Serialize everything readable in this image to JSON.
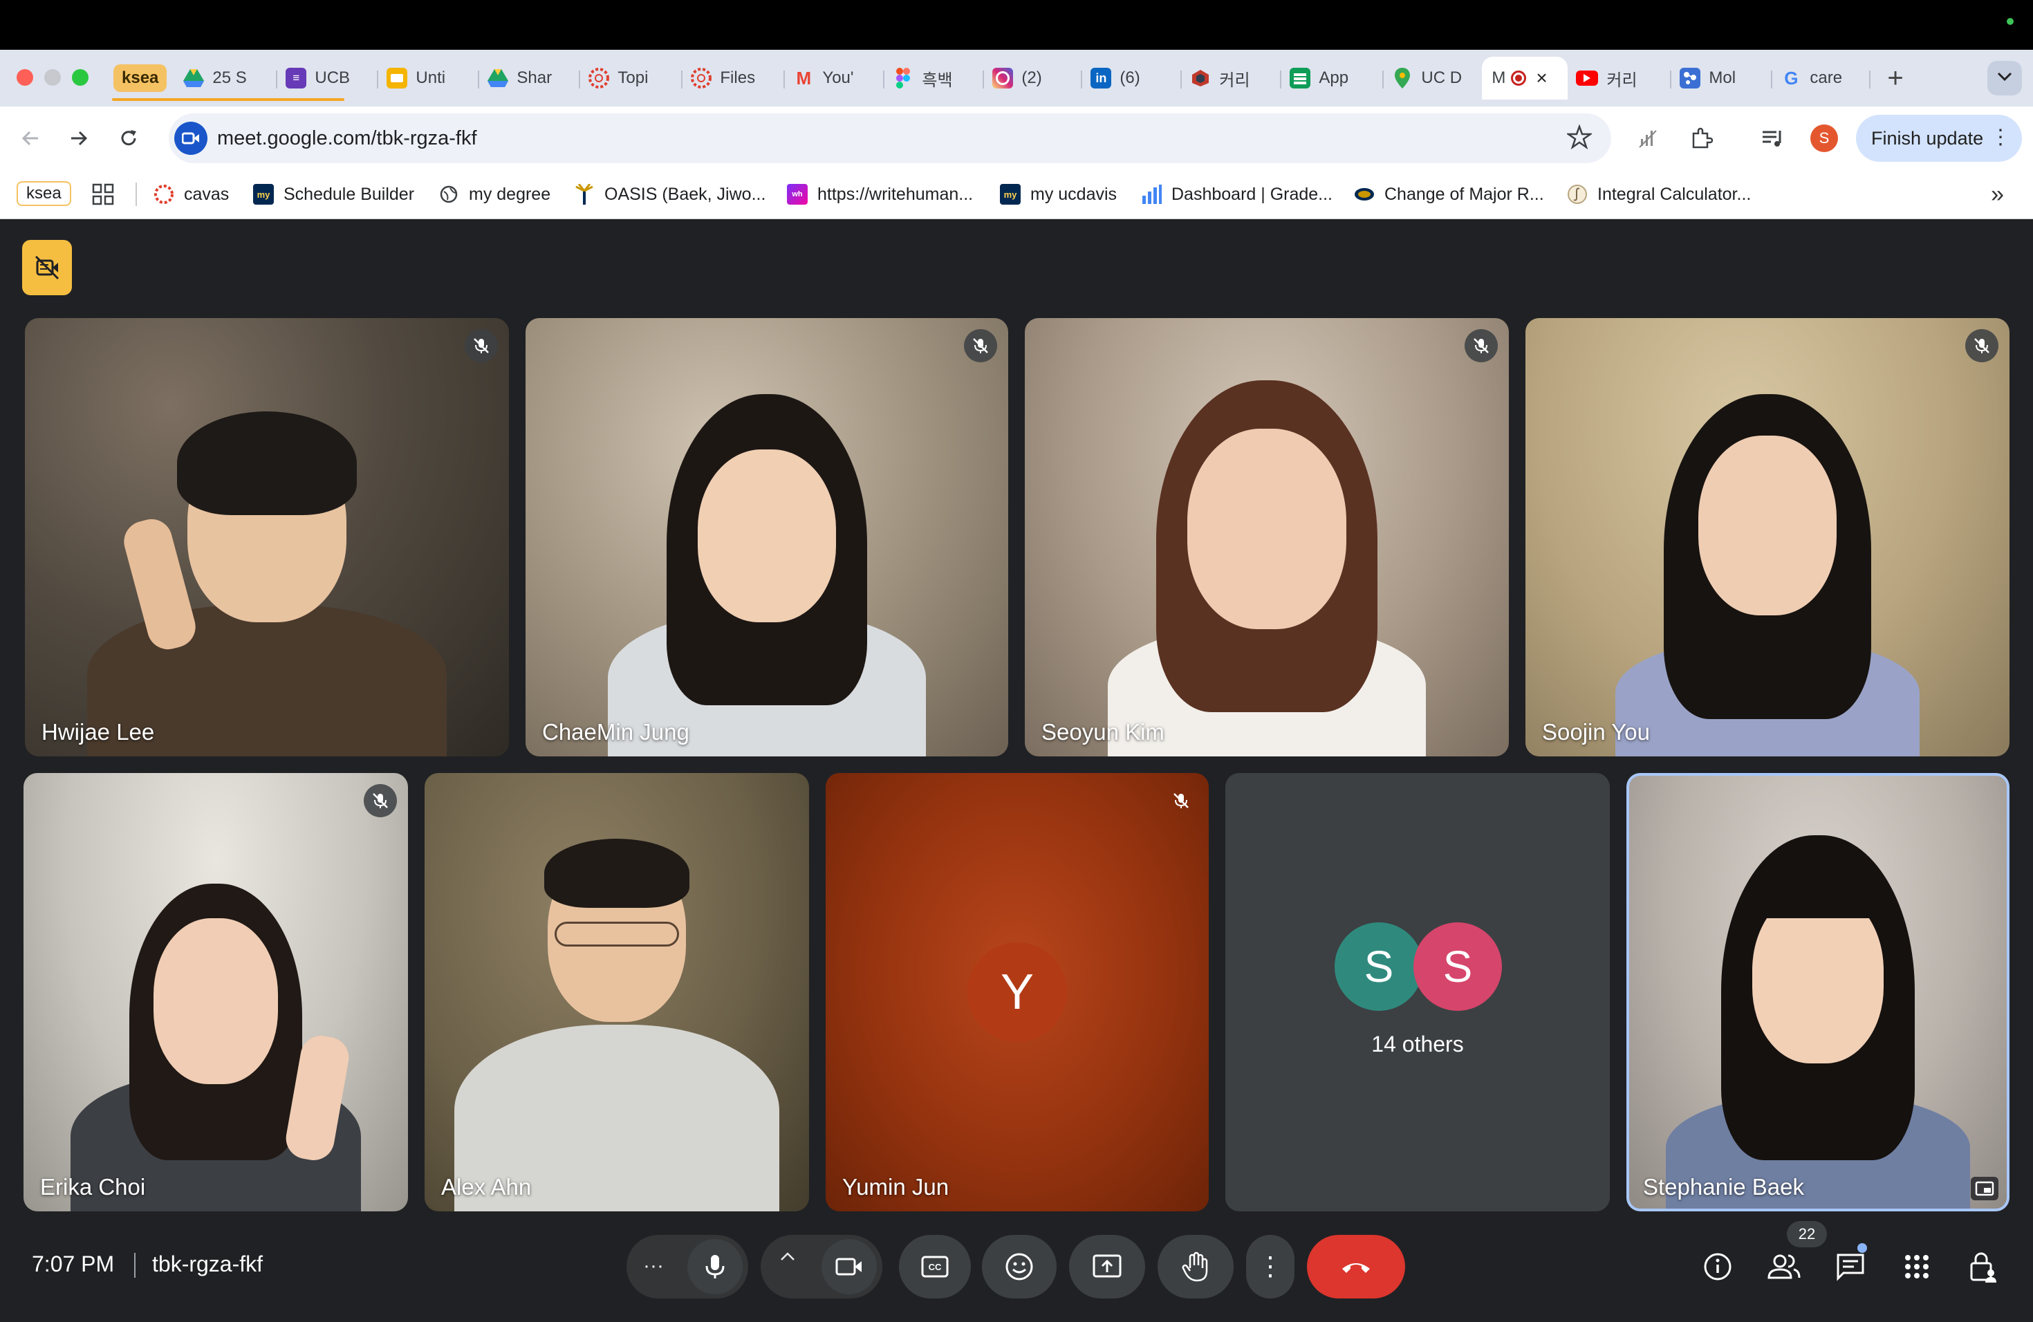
{
  "browser": {
    "tab_group_label": "ksea",
    "tabs": [
      {
        "title": "25 S",
        "icon": "google-drive-icon",
        "color": "#1fa463"
      },
      {
        "title": "UCB",
        "icon": "google-forms-icon",
        "color": "#673ab7"
      },
      {
        "title": "Unti",
        "icon": "google-slides-icon",
        "color": "#f4b400"
      },
      {
        "title": "Shar",
        "icon": "google-drive-icon",
        "color": "#1fa463"
      },
      {
        "title": "Topi",
        "icon": "canvas-icon",
        "color": "#e03e2d"
      },
      {
        "title": "Files",
        "icon": "canvas-icon",
        "color": "#e03e2d"
      },
      {
        "title": "You'",
        "icon": "gmail-icon",
        "color": "#ea4335"
      },
      {
        "title": "흑백",
        "icon": "figma-icon",
        "color": "#f24e1e"
      },
      {
        "title": "(2) ",
        "icon": "instagram-icon",
        "color": "#d62976"
      },
      {
        "title": "(6) ",
        "icon": "linkedin-icon",
        "color": "#0a66c2"
      },
      {
        "title": "커리",
        "icon": "app-icon",
        "color": "#c0392b"
      },
      {
        "title": "App",
        "icon": "google-sheets-icon",
        "color": "#0f9d58"
      },
      {
        "title": "UC D",
        "icon": "google-maps-icon",
        "color": "#34a853"
      },
      {
        "title": "M",
        "icon": "google-meet-icon",
        "color": "#1a73e8",
        "active": true
      },
      {
        "title": "커리",
        "icon": "youtube-icon",
        "color": "#ff0000"
      },
      {
        "title": "Mol",
        "icon": "molview-icon",
        "color": "#3b6fd4"
      },
      {
        "title": "care",
        "icon": "google-icon",
        "color": "#4285f4"
      }
    ],
    "new_tab_label": "+",
    "url": "meet.google.com/tbk-rgza-fkf",
    "profile_initial": "S",
    "finish_update_label": "Finish update",
    "bookmarks_group_label": "ksea",
    "bookmarks": [
      {
        "label": "cavas",
        "icon": "canvas-icon"
      },
      {
        "label": "Schedule Builder",
        "icon": "myucdavis-icon"
      },
      {
        "label": "my degree",
        "icon": "globe-icon"
      },
      {
        "label": "OASIS (Baek, Jiwo...",
        "icon": "oasis-icon"
      },
      {
        "label": "https://writehuman...",
        "icon": "writehuman-icon"
      },
      {
        "label": "my ucdavis",
        "icon": "myucdavis-icon"
      },
      {
        "label": "Dashboard | Grade...",
        "icon": "gradescope-icon"
      },
      {
        "label": "Change of Major R...",
        "icon": "ucdavis-icon"
      },
      {
        "label": "Integral Calculator...",
        "icon": "integral-icon"
      }
    ]
  },
  "meet": {
    "participants_top": [
      {
        "name": "Hwijae Lee",
        "muted": true
      },
      {
        "name": "ChaeMin Jung",
        "muted": true
      },
      {
        "name": "Seoyun Kim",
        "muted": true
      },
      {
        "name": "Soojin You",
        "muted": true
      }
    ],
    "participants_bottom": [
      {
        "name": "Erika Choi",
        "muted": true
      },
      {
        "name": "Alex Ahn",
        "muted": false
      },
      {
        "name": "Yumin Jun",
        "muted": true,
        "avatar": "Y"
      },
      {
        "others_label": "14 others",
        "avatars": [
          "S",
          "S"
        ]
      },
      {
        "name": "Stephanie Baek",
        "self": true
      }
    ],
    "time": "7:07 PM",
    "meeting_code": "tbk-rgza-fkf",
    "participant_count": "22",
    "colors": {
      "end_call": "#dc362e",
      "avatar_y": "#b23a14",
      "avatar_s1": "#2f8a7d",
      "avatar_s2": "#d6456b",
      "accent": "#a8c7fa"
    }
  }
}
